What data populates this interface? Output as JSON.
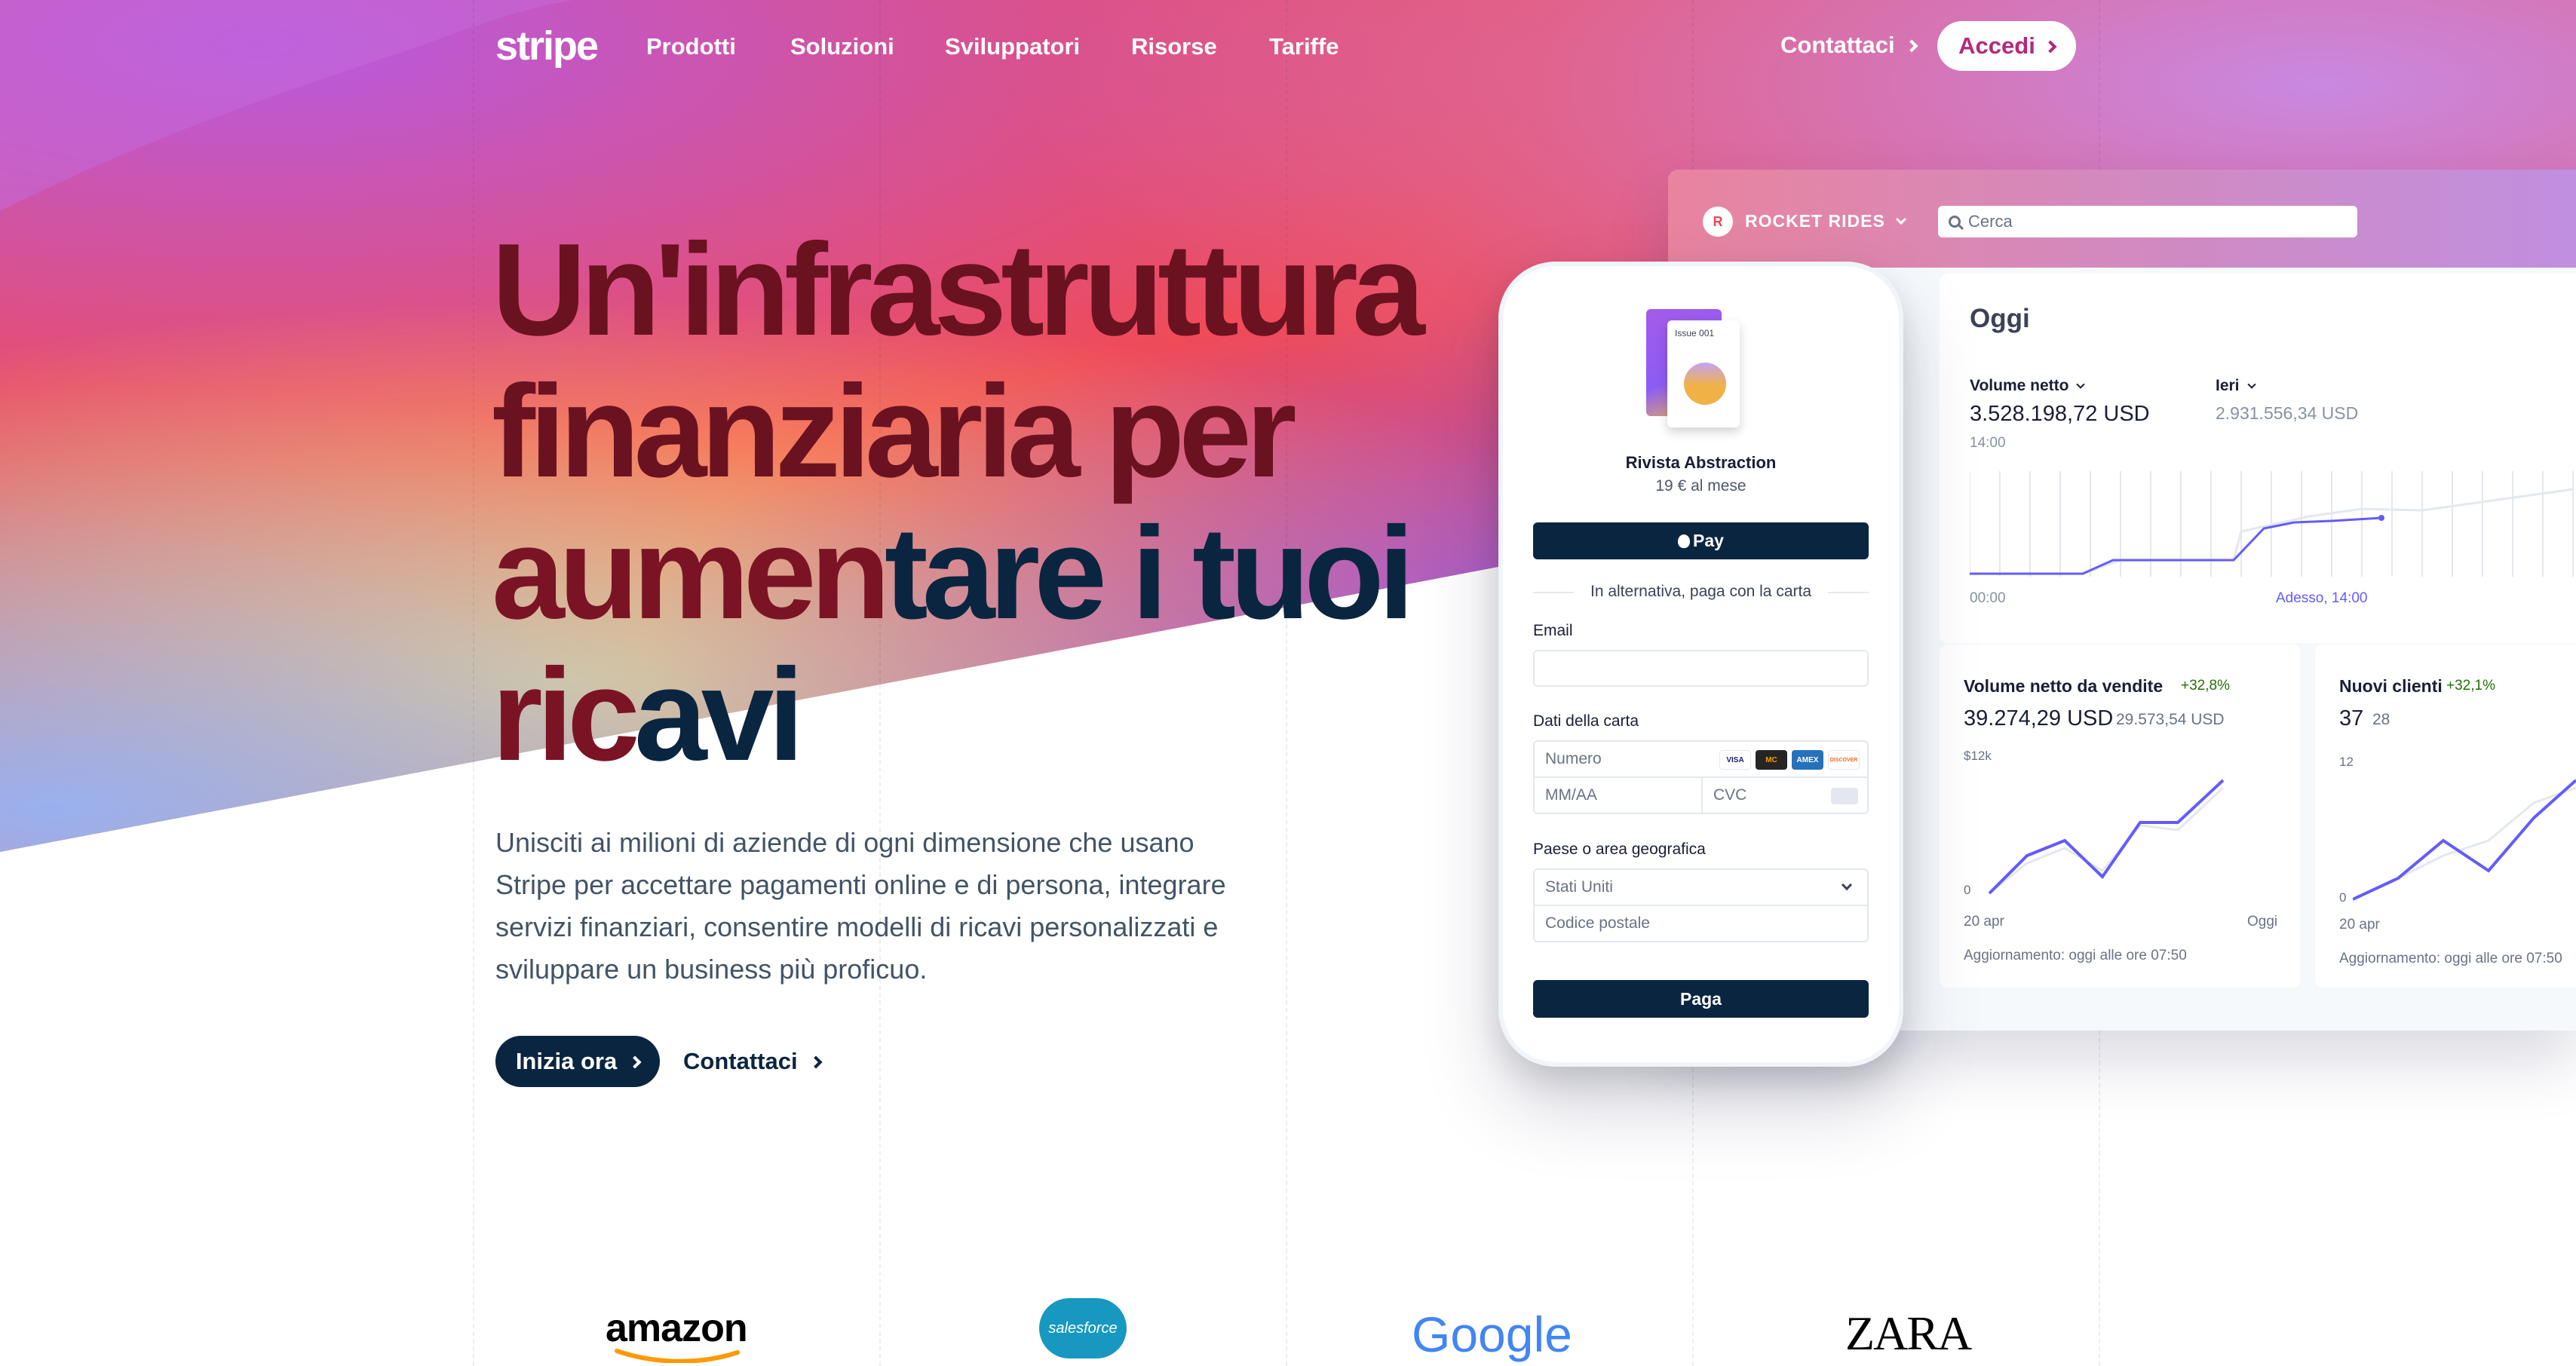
{
  "nav": {
    "logo": "stripe",
    "items": [
      "Prodotti",
      "Soluzioni",
      "Sviluppatori",
      "Risorse",
      "Tariffe"
    ],
    "contact": "Contattaci",
    "login": "Accedi"
  },
  "hero": {
    "headline": {
      "line1": "Un'infrastruttura",
      "line2": "finanziaria per",
      "line3a": "aumen",
      "line3b": "tare i tuoi",
      "line4a": "ric",
      "line4b": "avi"
    },
    "subtext": "Unisciti ai milioni di aziende di ogni dimensione che usano Stripe per accettare pagamenti online e di persona, integrare servizi finanziari, consentire modelli di ricavi personalizzati e sviluppare un business più proficuo.",
    "cta_primary": "Inizia ora",
    "cta_secondary": "Contattaci"
  },
  "dashboard": {
    "brand": "ROCKET RIDES",
    "search_placeholder": "Cerca",
    "today": {
      "title": "Oggi",
      "net_volume_label": "Volume netto",
      "net_volume_value": "3.528.198,72 USD",
      "net_volume_time": "14:00",
      "yesterday_label": "Ieri",
      "yesterday_value": "2.931.556,34 USD",
      "axis_start": "00:00",
      "axis_now": "Adesso, 14:00"
    },
    "sales": {
      "title": "Volume netto da vendite",
      "delta": "+32,8%",
      "value": "39.274,29 USD",
      "previous": "29.573,54 USD",
      "y_top": "$12k",
      "y_zero": "0",
      "x_start": "20 apr",
      "x_end": "Oggi",
      "updated": "Aggiornamento: oggi alle ore 07:50"
    },
    "customers": {
      "title": "Nuovi clienti",
      "delta": "+32,1%",
      "value": "37",
      "previous": "28",
      "y_top": "12",
      "y_zero": "0",
      "x_start": "20 apr",
      "updated": "Aggiornamento: oggi alle ore 07:50"
    }
  },
  "checkout": {
    "issue_label": "Issue 001",
    "product_name": "Rivista Abstraction",
    "price": "19 € al mese",
    "apple_pay": "Pay",
    "divider": "In alternativa, paga con la carta",
    "email_label": "Email",
    "card_label": "Dati della carta",
    "card_number_placeholder": "Numero",
    "expiry_placeholder": "MM/AA",
    "cvc_placeholder": "CVC",
    "card_brands": [
      "VISA",
      "MC",
      "AMEX",
      "DISCOVER"
    ],
    "country_label": "Paese o area geografica",
    "country_value": "Stati Uniti",
    "postal_placeholder": "Codice postale",
    "pay_button": "Paga"
  },
  "logos": [
    "amazon",
    "salesforce",
    "Google",
    "ZARA"
  ],
  "colors": {
    "navy": "#0a2540",
    "accent": "#635bff",
    "login_text": "#b4297a",
    "headline_red": "#6b1221",
    "positive": "#217005"
  }
}
